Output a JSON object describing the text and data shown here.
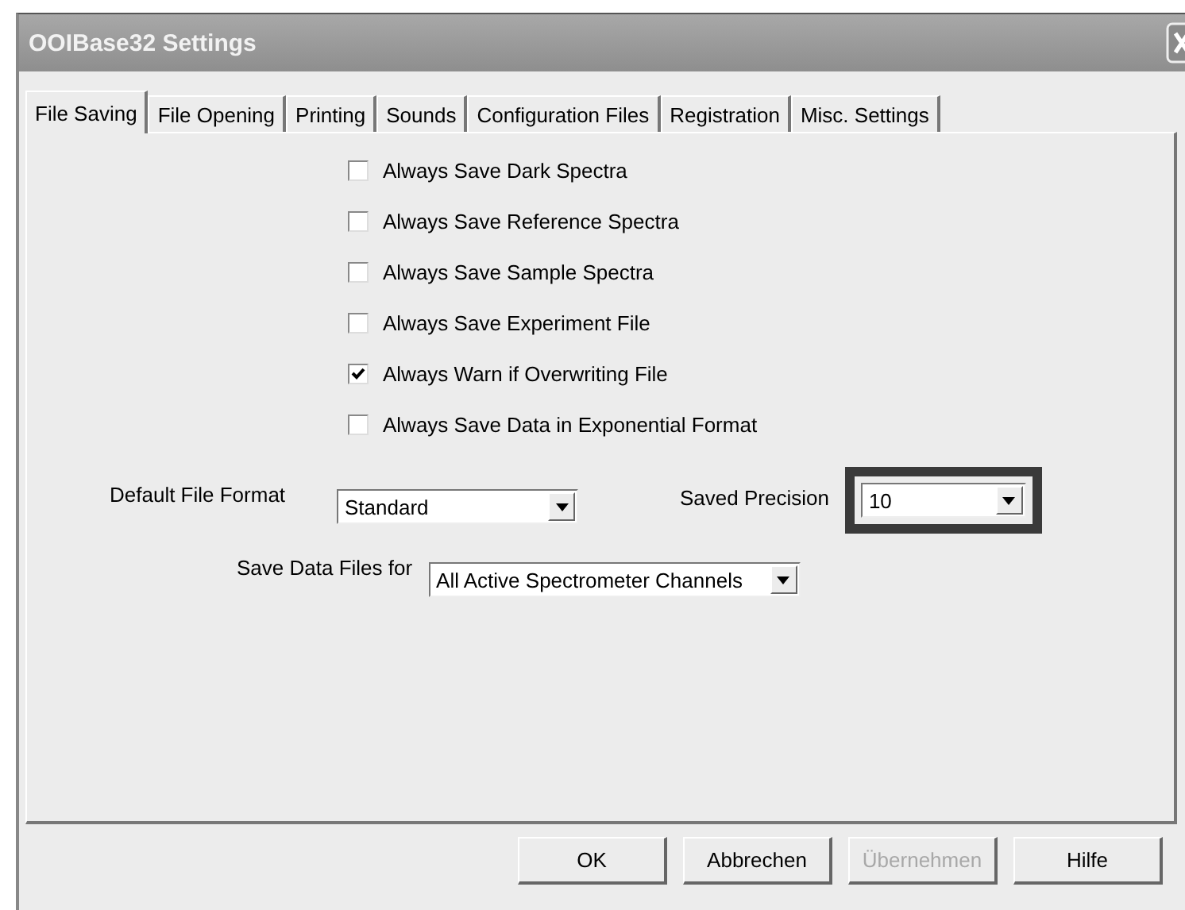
{
  "window": {
    "title": "OOIBase32 Settings"
  },
  "tabs": [
    {
      "label": "File Saving",
      "selected": true
    },
    {
      "label": "File Opening",
      "selected": false
    },
    {
      "label": "Printing",
      "selected": false
    },
    {
      "label": "Sounds",
      "selected": false
    },
    {
      "label": "Configuration Files",
      "selected": false
    },
    {
      "label": "Registration",
      "selected": false
    },
    {
      "label": "Misc. Settings",
      "selected": false
    }
  ],
  "checkboxes": [
    {
      "label": "Always Save Dark Spectra",
      "checked": false
    },
    {
      "label": "Always Save Reference Spectra",
      "checked": false
    },
    {
      "label": "Always Save Sample Spectra",
      "checked": false
    },
    {
      "label": "Always Save Experiment File",
      "checked": false
    },
    {
      "label": "Always Warn if Overwriting File",
      "checked": true
    },
    {
      "label": "Always Save Data in Exponential Format",
      "checked": false
    }
  ],
  "default_file_format": {
    "label": "Default File Format",
    "value": "Standard"
  },
  "saved_precision": {
    "label": "Saved Precision",
    "value": "10",
    "highlighted": true
  },
  "save_data_files_for": {
    "label": "Save Data Files for",
    "value": "All Active Spectrometer Channels"
  },
  "buttons": [
    {
      "label": "OK",
      "disabled": false
    },
    {
      "label": "Abbrechen",
      "disabled": false
    },
    {
      "label": "Übernehmen",
      "disabled": true
    },
    {
      "label": "Hilfe",
      "disabled": false
    }
  ]
}
